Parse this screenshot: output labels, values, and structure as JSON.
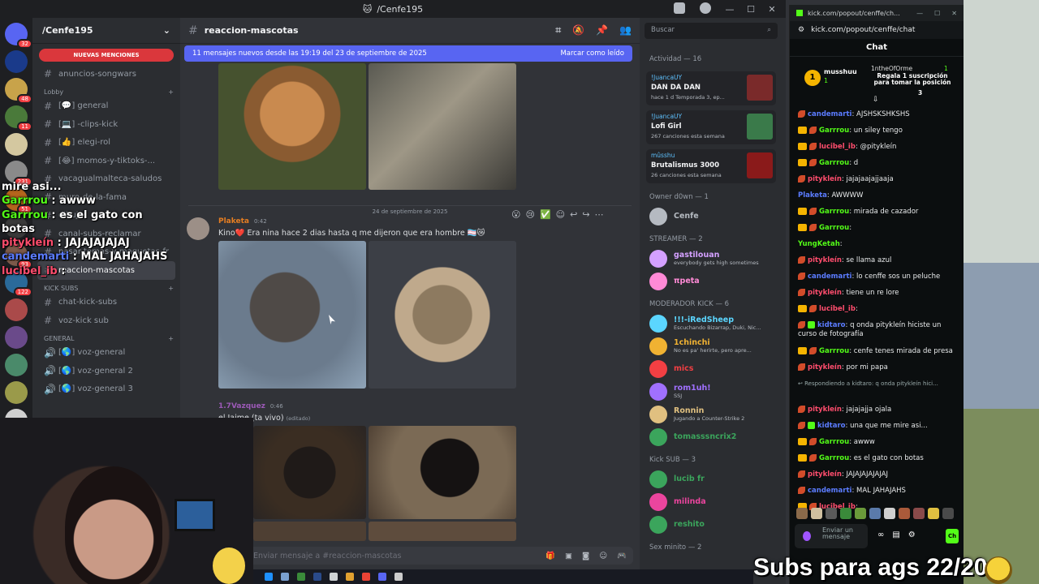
{
  "discord": {
    "window_title": "/Cenfe195",
    "server_name": "/Cenfe195",
    "mentions_label": "NUEVAS MENCIONES",
    "server_badges": [
      "32",
      "",
      "48",
      "11",
      "",
      "231",
      "51",
      "",
      "93",
      "122",
      "",
      "",
      "",
      "",
      "7"
    ],
    "channels": [
      {
        "prefix": "#",
        "name": "anuncios-songwars"
      },
      {
        "prefix": "cat",
        "name": "Lobby"
      },
      {
        "prefix": "#",
        "name": "[💬] general"
      },
      {
        "prefix": "#",
        "name": "[💻] -clips-kick"
      },
      {
        "prefix": "#",
        "name": "[👍] elegi-rol"
      },
      {
        "prefix": "#",
        "name": "[😂] momos-y-tiktoks-..."
      },
      {
        "prefix": "#",
        "name": "vacagualmalteca-saludos"
      },
      {
        "prefix": "#",
        "name": "muro-de-la-fama"
      },
      {
        "prefix": "#",
        "name": "dibujos"
      },
      {
        "prefix": "#",
        "name": "canal-subs-reclamar"
      },
      {
        "prefix": "#",
        "name": "pasar-temas-y-maquetas-fr"
      },
      {
        "prefix": "#",
        "name": "reaccion-mascotas",
        "active": true
      },
      {
        "prefix": "cat",
        "name": "KICK SUBS"
      },
      {
        "prefix": "#",
        "name": "chat-kick-subs"
      },
      {
        "prefix": "#",
        "name": "voz-kick sub"
      },
      {
        "prefix": "cat",
        "name": "GENERAL"
      },
      {
        "prefix": "🔊",
        "name": "[🌎] voz-general"
      },
      {
        "prefix": "🔊",
        "name": "[🌎] voz-general 2"
      },
      {
        "prefix": "🔊",
        "name": "[🌎] voz-general 3"
      }
    ],
    "channel_header": "reaccion-mascotas",
    "new_messages_banner": "11 mensajes nuevos desde las 19:19 del 23 de septiembre de 2025",
    "mark_read": "Marcar como leído",
    "date_divider": "24 de septiembre de 2025",
    "messages": [
      {
        "user": "Plaketa",
        "time": "0:42",
        "text": "Kino❤️ Era nina hace 2 dias hasta q me dijeron que era hombre 🏳️‍⚧️😿",
        "color": "#e67e22"
      },
      {
        "user": "1.7Vazquez",
        "time": "0:46",
        "text": "el Jaime (ta vivo)",
        "edited": "(editado)",
        "color": "#9b59b6"
      }
    ],
    "composer_placeholder": "Enviar mensaje a #reaccion-mascotas",
    "search_placeholder": "Buscar",
    "activity_header": "Actividad — 16",
    "activity": [
      {
        "user": "!JuancaUY",
        "title": "DAN DA DAN",
        "sub": "hace 1 d  Temporada 3, ep..."
      },
      {
        "user": "!JuancaUY",
        "title": "Lofi Girl",
        "sub": "267 canciones esta semana"
      },
      {
        "user": "mûsshu",
        "title": "Brutalismus 3000",
        "sub": "26 canciones esta semana"
      }
    ],
    "member_groups": [
      {
        "label": "Owner d0wn — 1",
        "members": [
          {
            "name": "Cenfe",
            "status": ""
          }
        ]
      },
      {
        "label": "STREAMER — 2",
        "members": [
          {
            "name": "gastilouan",
            "status": "everybody gets high sometimes"
          },
          {
            "name": "πpeta",
            "status": ""
          }
        ]
      },
      {
        "label": "MODERADOR KICK — 6",
        "members": [
          {
            "name": "!!!-iRedSheep",
            "status": "Escuchando Bizarrap, Duki, Nic..."
          },
          {
            "name": "1chinchi",
            "status": "No es pa' herirte, pero apre..."
          },
          {
            "name": "mics",
            "status": ""
          },
          {
            "name": "rom1uh!",
            "status": "SSJ"
          },
          {
            "name": "Ronnin",
            "status": "Jugando a Counter-Strike 2"
          },
          {
            "name": "tomasssncrix2",
            "status": ""
          }
        ]
      },
      {
        "label": "Kick SUB — 3",
        "members": [
          {
            "name": "lucib fr",
            "status": ""
          },
          {
            "name": "milinda",
            "status": ""
          },
          {
            "name": "reshito",
            "status": ""
          }
        ]
      },
      {
        "label": "Sex minito — 2",
        "members": []
      }
    ]
  },
  "kick": {
    "tab_title": "kick.com/popout/cenffe/ch...",
    "url": "kick.com/popout/cenffe/chat",
    "chat_title": "Chat",
    "pinned": {
      "rank": "1",
      "user1": "musshuu",
      "count1": "1",
      "user2": "1ntheOfOrme",
      "count2": "1",
      "text": "Regala 1 suscripción para tomar la posición",
      "target": "3"
    },
    "messages": [
      {
        "badges": [
          "b2"
        ],
        "user": "candemarti",
        "text": "AJSHSKSHKSHS",
        "color": "#5b7cff"
      },
      {
        "badges": [
          "b1",
          "b2"
        ],
        "user": "Garrrou",
        "text": "un siley tengo",
        "color": "#53fc18"
      },
      {
        "badges": [
          "b1",
          "b2"
        ],
        "user": "lucibel_ib",
        "text": "@pitykleín",
        "color": "#ff4d6d"
      },
      {
        "badges": [
          "b1",
          "b2"
        ],
        "user": "Garrrou",
        "text": "d",
        "color": "#53fc18"
      },
      {
        "badges": [
          "b2"
        ],
        "user": "pitykleín",
        "text": "jajajaajajjaaja",
        "color": "#ff4d6d"
      },
      {
        "badges": [],
        "user": "Plaketa",
        "text": "AWWWW",
        "color": "#5b7cff"
      },
      {
        "badges": [
          "b1",
          "b2"
        ],
        "user": "Garrrou",
        "text": "mirada de cazador",
        "color": "#53fc18"
      },
      {
        "badges": [
          "b1",
          "b2"
        ],
        "user": "Garrrou",
        "text": "",
        "color": "#53fc18"
      },
      {
        "badges": [],
        "user": "YungKetah",
        "text": "",
        "color": "#53fc18"
      },
      {
        "badges": [
          "b2"
        ],
        "user": "pitykleín",
        "text": "se llama azul",
        "color": "#ff4d6d"
      },
      {
        "badges": [
          "b2"
        ],
        "user": "candemarti",
        "text": "lo cenffe sos un peluche",
        "color": "#5b7cff"
      },
      {
        "badges": [
          "b2"
        ],
        "user": "pitykleín",
        "text": "tiene un re lore",
        "color": "#ff4d6d"
      },
      {
        "badges": [
          "b1",
          "b2"
        ],
        "user": "lucibel_ib",
        "text": "",
        "color": "#ff4d6d"
      },
      {
        "badges": [
          "b2",
          "b3"
        ],
        "user": "kidtaro",
        "text": "q onda pitykleín hiciste un curso de fotografía",
        "color": "#5b7cff"
      },
      {
        "badges": [
          "b1",
          "b2"
        ],
        "user": "Garrrou",
        "text": "cenfe tenes mirada de presa",
        "color": "#53fc18"
      },
      {
        "badges": [
          "b2"
        ],
        "user": "pitykleín",
        "text": "por mi papa",
        "color": "#ff4d6d"
      },
      {
        "badges": [],
        "user": "",
        "text": "↩ Respondiendo a kidtaro: q onda pitykleín hici...",
        "color": "#9aa"
      },
      {
        "badges": [
          "b2"
        ],
        "user": "pitykleín",
        "text": "jajajajja ojala",
        "color": "#ff4d6d"
      },
      {
        "badges": [
          "b2",
          "b3"
        ],
        "user": "kidtaro",
        "text": "una que me mire asi...",
        "color": "#5b7cff"
      },
      {
        "badges": [
          "b1",
          "b2"
        ],
        "user": "Garrrou",
        "text": "awww",
        "color": "#53fc18"
      },
      {
        "badges": [
          "b1",
          "b2"
        ],
        "user": "Garrrou",
        "text": "es el gato con botas",
        "color": "#53fc18"
      },
      {
        "badges": [
          "b2"
        ],
        "user": "pitykleín",
        "text": "JAJAJAJAJAJAJ",
        "color": "#ff4d6d"
      },
      {
        "badges": [
          "b2"
        ],
        "user": "candemarti",
        "text": "MAL JAHAJAHS",
        "color": "#5b7cff"
      },
      {
        "badges": [
          "b1",
          "b2"
        ],
        "user": "lucibel_ib",
        "text": "",
        "color": "#ff4d6d"
      }
    ],
    "input_placeholder": "Enviar un mensaje",
    "send_label": "Ch"
  },
  "overlay": {
    "chat_lines": [
      {
        "user": "",
        "text": "mire asi...",
        "cls": ""
      },
      {
        "user": "Garrrou",
        "text": ": awww",
        "cls": "u1"
      },
      {
        "user": "Garrrou",
        "text": ": es el gato con botas",
        "cls": "u1"
      },
      {
        "user": "pitykleín",
        "text": ": JAJAJAJAJAJ",
        "cls": "u2"
      },
      {
        "user": "candemarti",
        "text": ": MAL JAHAJAHS",
        "cls": "u3"
      },
      {
        "user": "lucibel_ib",
        "text": ":",
        "cls": "u2"
      }
    ],
    "subs_goal": "Subs para ags 22/20"
  }
}
